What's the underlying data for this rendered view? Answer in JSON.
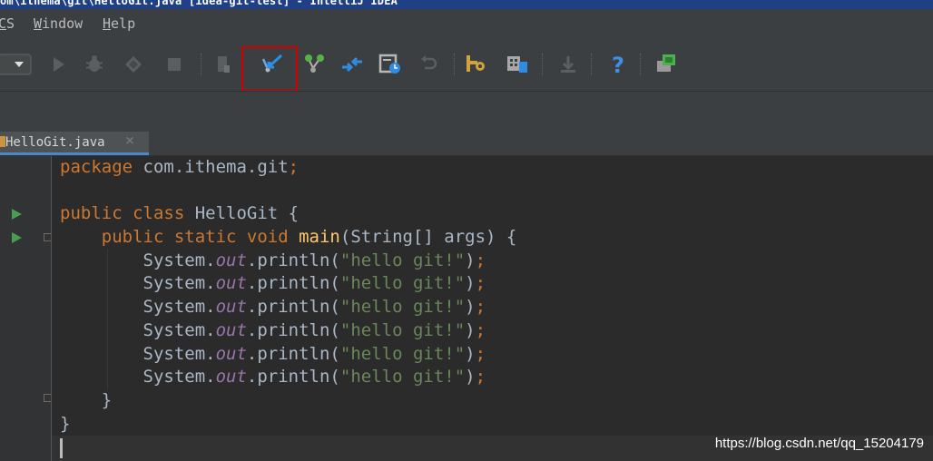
{
  "window": {
    "title": "om\\ithema\\git\\HelloGit.java [idea-git-test] - IntelliJ IDEA"
  },
  "menu": {
    "items": [
      {
        "mnemonic": "C",
        "rest": "S"
      },
      {
        "mnemonic": "W",
        "rest": "indow"
      },
      {
        "mnemonic": "H",
        "rest": "elp"
      }
    ]
  },
  "toolbar": {
    "icons": [
      "run-config-dropdown-icon",
      "run-icon",
      "debug-icon",
      "coverage-icon",
      "stop-icon",
      "build-icon",
      "vcs-update-icon",
      "vcs-branch-icon",
      "vcs-compare-icon",
      "vcs-history-icon",
      "vcs-revert-icon",
      "project-structure-icon",
      "sdk-settings-icon",
      "download-icon",
      "help-icon",
      "plugin-icon"
    ],
    "highlighted": "vcs-update-icon"
  },
  "editor": {
    "tab": {
      "filename": "HelloGit.java",
      "close": "×"
    },
    "lines": [
      [
        {
          "t": "package ",
          "c": "kw"
        },
        {
          "t": "com.ithema.git",
          "c": "pl"
        },
        {
          "t": ";",
          "c": "kw"
        }
      ],
      [],
      [
        {
          "t": "public class ",
          "c": "kw"
        },
        {
          "t": "HelloGit {",
          "c": "pl"
        }
      ],
      [
        {
          "t": "    public static void ",
          "c": "kw"
        },
        {
          "t": "main",
          "c": "fn"
        },
        {
          "t": "(String[] args) {",
          "c": "pl"
        }
      ],
      [
        {
          "t": "        System.",
          "c": "pl"
        },
        {
          "t": "out",
          "c": "fld"
        },
        {
          "t": ".println(",
          "c": "pl"
        },
        {
          "t": "\"hello git!\"",
          "c": "str"
        },
        {
          "t": ")",
          "c": "pl"
        },
        {
          "t": ";",
          "c": "kw"
        }
      ],
      [
        {
          "t": "        System.",
          "c": "pl"
        },
        {
          "t": "out",
          "c": "fld"
        },
        {
          "t": ".println(",
          "c": "pl"
        },
        {
          "t": "\"hello git!\"",
          "c": "str"
        },
        {
          "t": ")",
          "c": "pl"
        },
        {
          "t": ";",
          "c": "kw"
        }
      ],
      [
        {
          "t": "        System.",
          "c": "pl"
        },
        {
          "t": "out",
          "c": "fld"
        },
        {
          "t": ".println(",
          "c": "pl"
        },
        {
          "t": "\"hello git!\"",
          "c": "str"
        },
        {
          "t": ")",
          "c": "pl"
        },
        {
          "t": ";",
          "c": "kw"
        }
      ],
      [
        {
          "t": "        System.",
          "c": "pl"
        },
        {
          "t": "out",
          "c": "fld"
        },
        {
          "t": ".println(",
          "c": "pl"
        },
        {
          "t": "\"hello git!\"",
          "c": "str"
        },
        {
          "t": ")",
          "c": "pl"
        },
        {
          "t": ";",
          "c": "kw"
        }
      ],
      [
        {
          "t": "        System.",
          "c": "pl"
        },
        {
          "t": "out",
          "c": "fld"
        },
        {
          "t": ".println(",
          "c": "pl"
        },
        {
          "t": "\"hello git!\"",
          "c": "str"
        },
        {
          "t": ")",
          "c": "pl"
        },
        {
          "t": ";",
          "c": "kw"
        }
      ],
      [
        {
          "t": "        System.",
          "c": "pl"
        },
        {
          "t": "out",
          "c": "fld"
        },
        {
          "t": ".println(",
          "c": "pl"
        },
        {
          "t": "\"hello git!\"",
          "c": "str"
        },
        {
          "t": ")",
          "c": "pl"
        },
        {
          "t": ";",
          "c": "kw"
        }
      ],
      [
        {
          "t": "    }",
          "c": "pl"
        }
      ],
      [
        {
          "t": "}",
          "c": "pl"
        }
      ]
    ]
  },
  "watermark": "https://blog.csdn.net/qq_15204179",
  "colors": {
    "keyword": "#cc7832",
    "method": "#ffc66d",
    "field": "#9876aa",
    "string": "#6a8759",
    "plain": "#a9b7c6",
    "highlight_box": "#d40000"
  }
}
